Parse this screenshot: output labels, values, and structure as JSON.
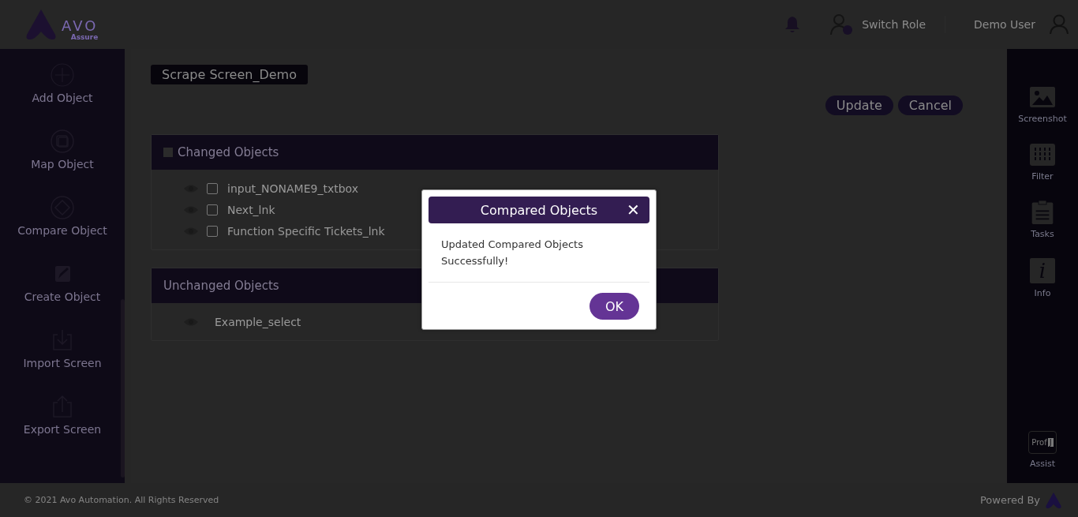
{
  "header": {
    "logo_text": "AVO",
    "logo_subtext": "Assure",
    "switch_role": "Switch Role",
    "user_name": "Demo User"
  },
  "left_sidebar": {
    "items": [
      {
        "kind": "add",
        "label": "Add Object"
      },
      {
        "kind": "map",
        "label": "Map Object"
      },
      {
        "kind": "compare",
        "label": "Compare Object"
      },
      {
        "kind": "create",
        "label": "Create Object"
      },
      {
        "kind": "import",
        "label": "Import Screen"
      },
      {
        "kind": "export",
        "label": "Export Screen"
      }
    ]
  },
  "screen_title": "Scrape Screen_Demo",
  "actions": [
    "Update",
    "Cancel"
  ],
  "sections": [
    {
      "title": "Changed Objects",
      "checked": false,
      "items": [
        {
          "name": "input_NONAME9_txtbox",
          "checked": false
        },
        {
          "name": "Next_lnk",
          "checked": false
        },
        {
          "name": "Function Specific Tickets_lnk",
          "checked": false
        }
      ]
    },
    {
      "title": "Unchanged Objects",
      "items": [
        {
          "name": "Example_select"
        }
      ]
    }
  ],
  "right_sidebar": {
    "items": [
      {
        "kind": "screenshot",
        "label": "Screenshot"
      },
      {
        "kind": "filter",
        "label": "Filter"
      },
      {
        "kind": "tasks",
        "label": "Tasks"
      },
      {
        "kind": "info",
        "label": "Info",
        "icon_text": "i"
      }
    ],
    "assist": {
      "label": "Assist",
      "icon_text": "Prof",
      "icon_badge": "J"
    }
  },
  "footer": {
    "copyright": "© 2021 Avo Automation. All Rights Reserved",
    "powered_by": "Powered By"
  },
  "dialog": {
    "title": "Compared Objects",
    "close": "✕",
    "message": "Updated Compared Objects Successfully!",
    "button": "OK"
  }
}
